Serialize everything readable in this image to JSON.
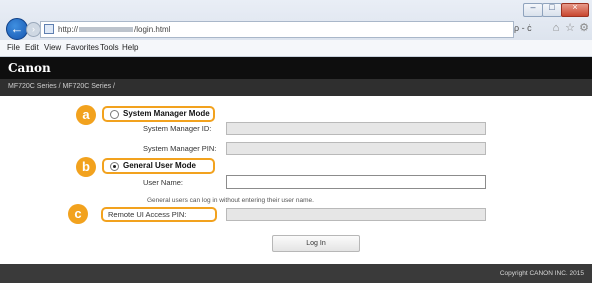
{
  "browser": {
    "url_prefix": "http://",
    "url_suffix": "/login.html",
    "search_label": "ρ - ċ",
    "menu": [
      "File",
      "Edit",
      "View",
      "Favorites",
      "Tools",
      "Help"
    ],
    "window_controls": {
      "minimize": "–",
      "maximize": "□",
      "close": "×"
    },
    "back_glyph": "←",
    "forward_glyph": "›",
    "toolbar_icons": [
      "home-icon",
      "favorites-icon",
      "settings-icon"
    ]
  },
  "header": {
    "brand": "Canon",
    "breadcrumb": "MF720C Series / MF720C Series /"
  },
  "form": {
    "callouts": [
      "a",
      "b",
      "c"
    ],
    "system_manager_mode": {
      "label": "System Manager Mode",
      "selected": false
    },
    "system_manager_id_label": "System Manager ID:",
    "system_manager_pin_label": "System Manager PIN:",
    "general_user_mode": {
      "label": "General User Mode",
      "selected": true
    },
    "user_name_label": "User Name:",
    "hint": "General users can log in without entering their user name.",
    "remote_ui_pin_label": "Remote UI Access PIN:",
    "login_button": "Log In"
  },
  "footer": {
    "copyright": "Copyright CANON INC. 2015"
  },
  "colors": {
    "callout": "#f2a21e",
    "header_bg": "#0e0e0e",
    "subheader_bg": "#2f2f2f",
    "footer_bg": "#3a3a3a",
    "disabled_field": "#e6e6e6"
  }
}
